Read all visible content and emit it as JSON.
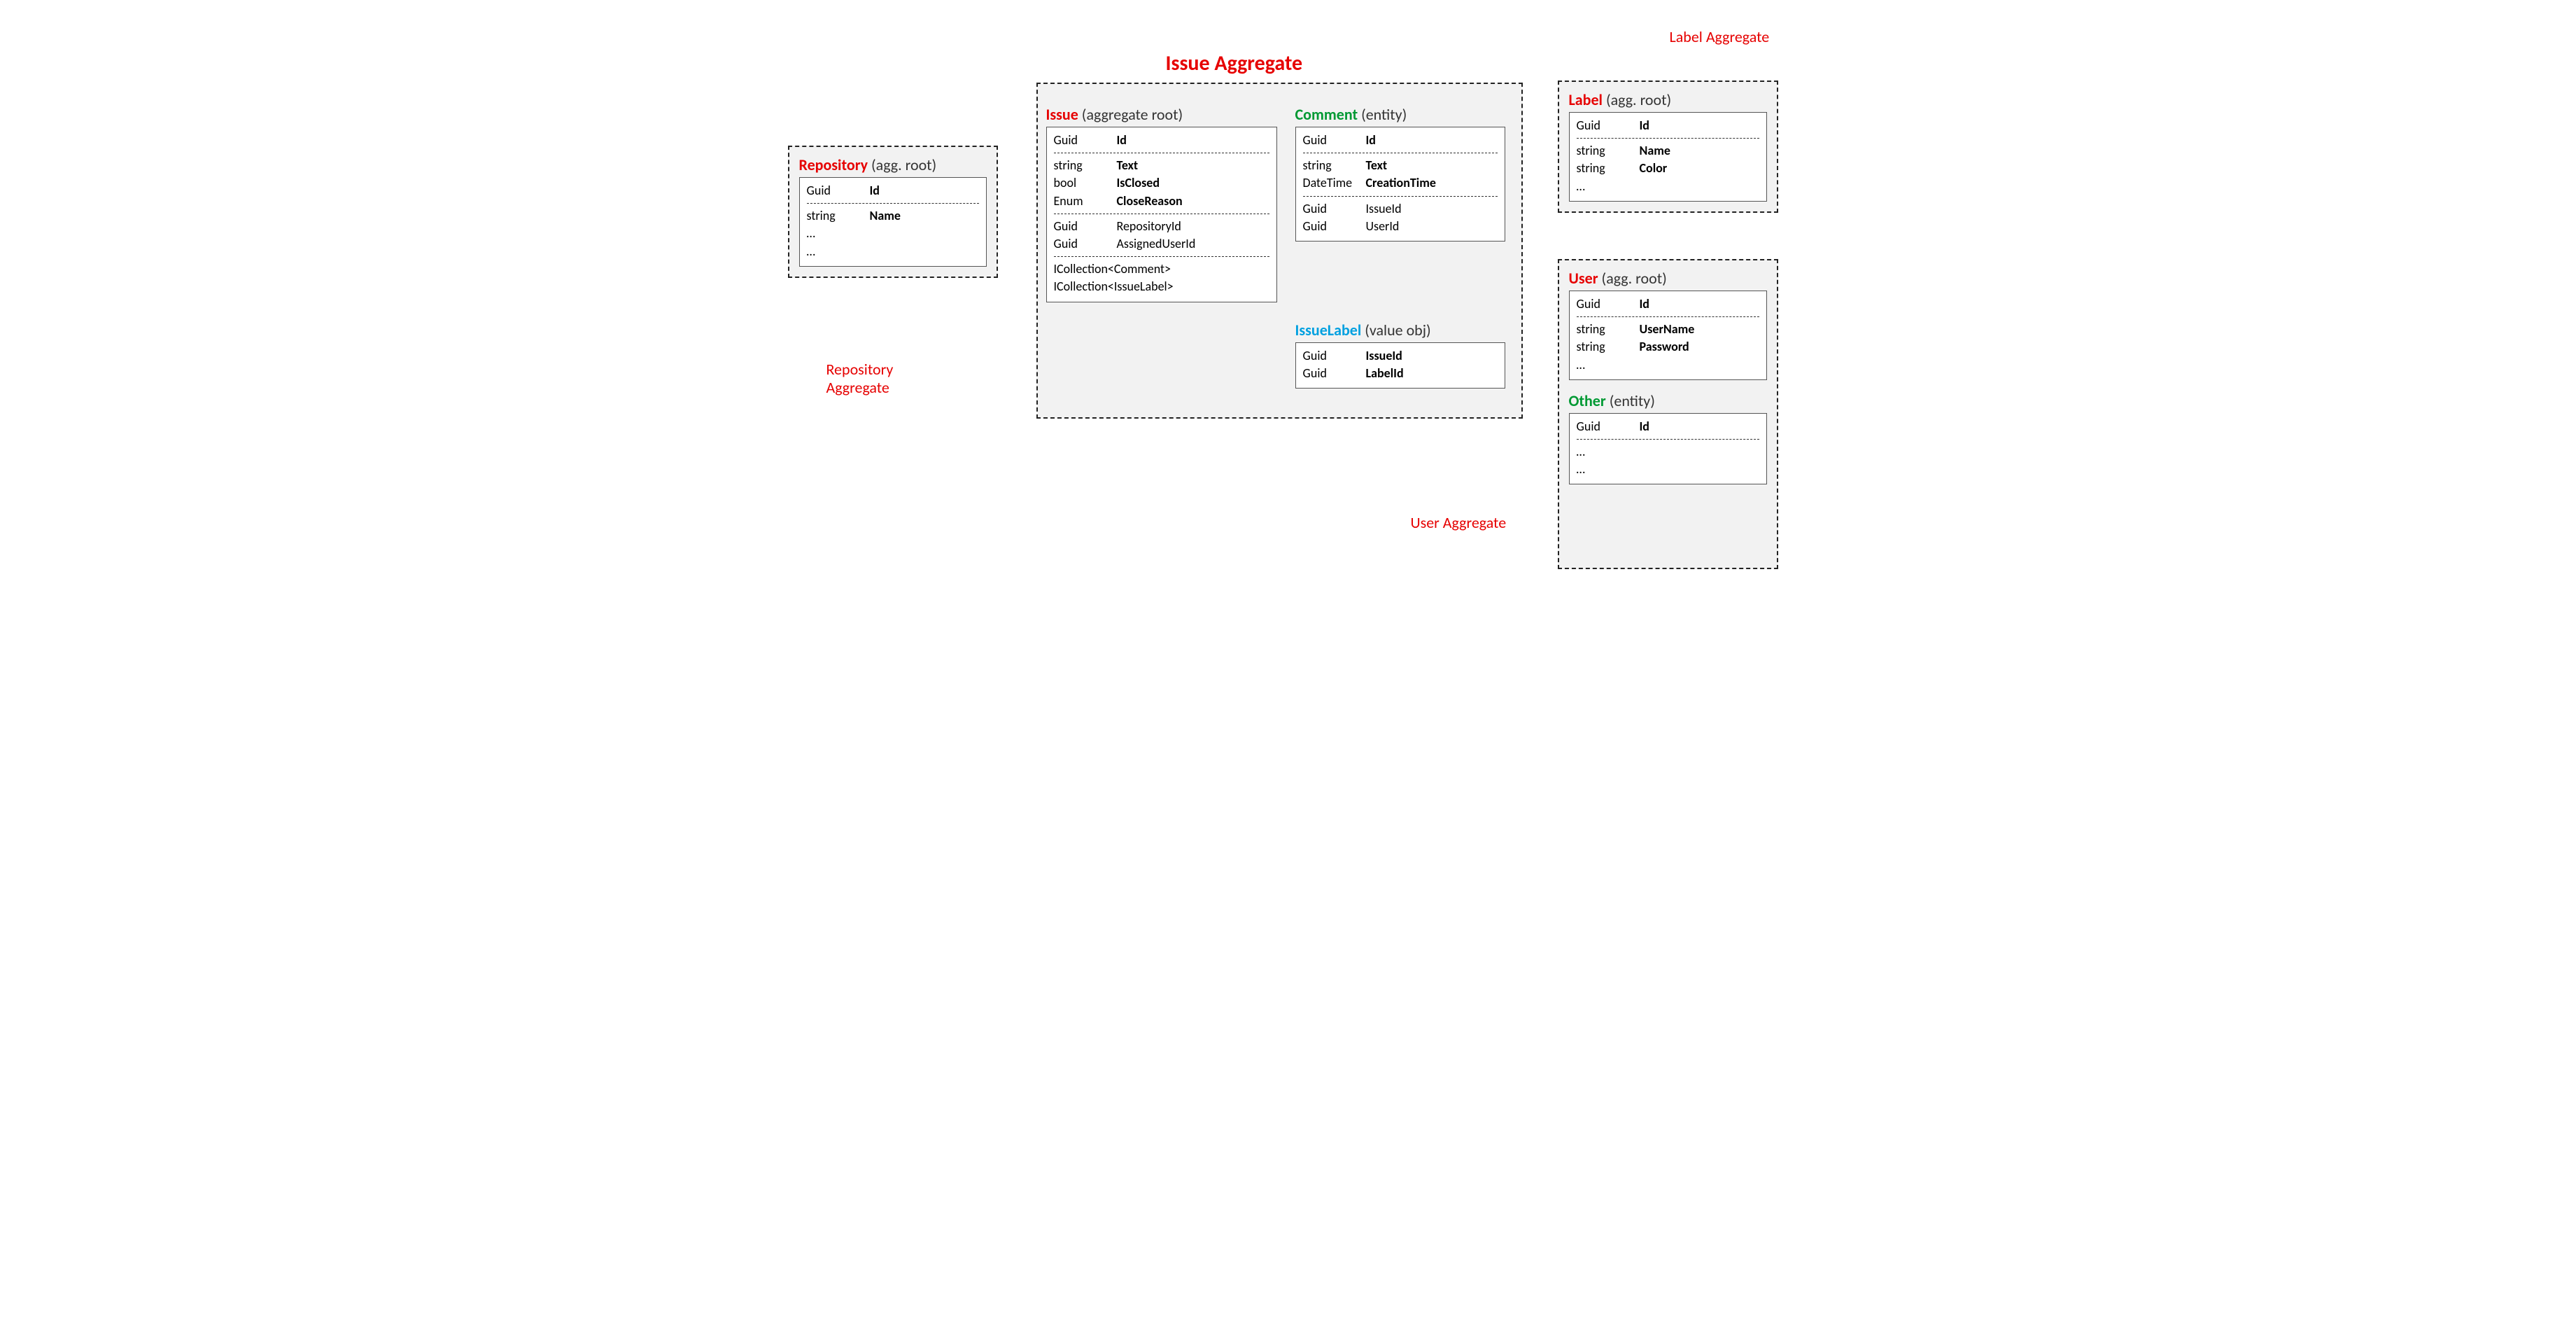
{
  "titles": {
    "issue_aggregate": "Issue Aggregate",
    "repository_aggregate": "Repository\nAggregate",
    "label_aggregate": "Label Aggregate",
    "user_aggregate": "User Aggregate"
  },
  "entities": {
    "repository": {
      "name": "Repository",
      "role": "(agg. root)",
      "sections": [
        [
          {
            "type": "Guid",
            "prop": "Id",
            "bold": true
          }
        ],
        [
          {
            "type": "string",
            "prop": "Name",
            "bold": true
          },
          {
            "type": "…",
            "prop": "",
            "bold": false
          },
          {
            "type": "…",
            "prop": "",
            "bold": false
          }
        ]
      ]
    },
    "issue": {
      "name": "Issue",
      "role": "(aggregate root)",
      "sections": [
        [
          {
            "type": "Guid",
            "prop": "Id",
            "bold": true
          }
        ],
        [
          {
            "type": "string",
            "prop": "Text",
            "bold": true
          },
          {
            "type": "bool",
            "prop": "IsClosed",
            "bold": true
          },
          {
            "type": "Enum",
            "prop": "CloseReason",
            "bold": true
          }
        ],
        [
          {
            "type": "Guid",
            "prop": "RepositoryId",
            "bold": false
          },
          {
            "type": "Guid",
            "prop": "AssignedUserId",
            "bold": false
          }
        ],
        [
          {
            "type": "ICollection<Comment>",
            "prop": "",
            "bold": false
          },
          {
            "type": "ICollection<IssueLabel>",
            "prop": "",
            "bold": false
          }
        ]
      ]
    },
    "comment": {
      "name": "Comment",
      "role": "(entity)",
      "sections": [
        [
          {
            "type": "Guid",
            "prop": "Id",
            "bold": true
          }
        ],
        [
          {
            "type": "string",
            "prop": "Text",
            "bold": true
          },
          {
            "type": "DateTime",
            "prop": "CreationTime",
            "bold": true
          }
        ],
        [
          {
            "type": "Guid",
            "prop": "IssueId",
            "bold": false
          },
          {
            "type": "Guid",
            "prop": "UserId",
            "bold": false
          }
        ]
      ]
    },
    "issuelabel": {
      "name": "IssueLabel",
      "role": "(value obj)",
      "sections": [
        [
          {
            "type": "Guid",
            "prop": "IssueId",
            "bold": true
          },
          {
            "type": "Guid",
            "prop": "LabelId",
            "bold": true
          }
        ]
      ]
    },
    "label": {
      "name": "Label",
      "role": "(agg. root)",
      "sections": [
        [
          {
            "type": "Guid",
            "prop": "Id",
            "bold": true
          }
        ],
        [
          {
            "type": "string",
            "prop": "Name",
            "bold": true
          },
          {
            "type": "string",
            "prop": "Color",
            "bold": true
          },
          {
            "type": "…",
            "prop": "",
            "bold": false
          }
        ]
      ]
    },
    "user": {
      "name": "User",
      "role": "(agg. root)",
      "sections": [
        [
          {
            "type": "Guid",
            "prop": "Id",
            "bold": true
          }
        ],
        [
          {
            "type": "string",
            "prop": "UserName",
            "bold": true
          },
          {
            "type": "string",
            "prop": "Password",
            "bold": true
          },
          {
            "type": "…",
            "prop": "",
            "bold": false
          }
        ]
      ]
    },
    "other": {
      "name": "Other",
      "role": "(entity)",
      "sections": [
        [
          {
            "type": "Guid",
            "prop": "Id",
            "bold": true
          }
        ],
        [
          {
            "type": "…",
            "prop": "",
            "bold": false
          },
          {
            "type": "…",
            "prop": "",
            "bold": false
          }
        ]
      ]
    }
  }
}
